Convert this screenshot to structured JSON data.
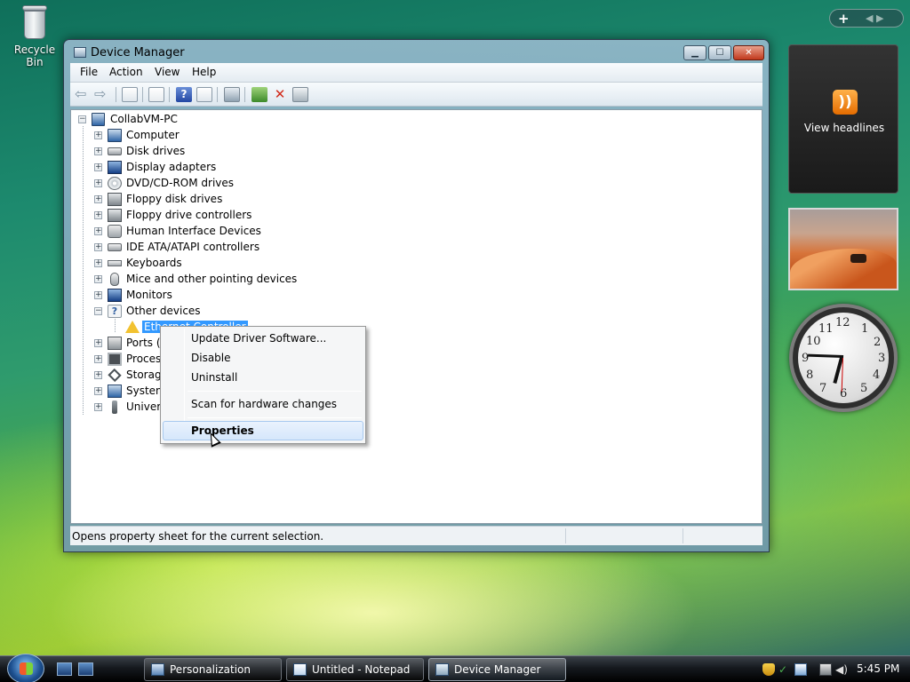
{
  "desktop": {
    "recycle_bin_label": "Recycle Bin"
  },
  "window": {
    "title": "Device Manager",
    "menu": [
      "File",
      "Action",
      "View",
      "Help"
    ],
    "status_text": "Opens property sheet for the current selection."
  },
  "tree": {
    "root": "CollabVM-PC",
    "nodes": [
      {
        "label": "Computer",
        "icon": "computer-icon",
        "expanded": false
      },
      {
        "label": "Disk drives",
        "icon": "disk-drive-icon",
        "expanded": false
      },
      {
        "label": "Display adapters",
        "icon": "display-adapter-icon",
        "expanded": false
      },
      {
        "label": "DVD/CD-ROM drives",
        "icon": "cd-drive-icon",
        "expanded": false
      },
      {
        "label": "Floppy disk drives",
        "icon": "floppy-drive-icon",
        "expanded": false
      },
      {
        "label": "Floppy drive controllers",
        "icon": "floppy-controller-icon",
        "expanded": false
      },
      {
        "label": "Human Interface Devices",
        "icon": "hid-icon",
        "expanded": false
      },
      {
        "label": "IDE ATA/ATAPI controllers",
        "icon": "ide-controller-icon",
        "expanded": false
      },
      {
        "label": "Keyboards",
        "icon": "keyboard-icon",
        "expanded": false
      },
      {
        "label": "Mice and other pointing devices",
        "icon": "mouse-icon",
        "expanded": false
      },
      {
        "label": "Monitors",
        "icon": "monitor-icon",
        "expanded": false
      },
      {
        "label": "Other devices",
        "icon": "unknown-device-icon",
        "expanded": true
      }
    ],
    "child": {
      "label": "Ethernet Controller",
      "icon": "warning-icon",
      "selected": true
    },
    "nodes_after": [
      {
        "label": "Ports (C",
        "icon": "port-icon"
      },
      {
        "label": "Process",
        "icon": "processor-icon"
      },
      {
        "label": "Storage",
        "icon": "storage-icon"
      },
      {
        "label": "System",
        "icon": "system-icon"
      },
      {
        "label": "Univers",
        "icon": "usb-icon"
      }
    ]
  },
  "context_menu": {
    "items": [
      {
        "label": "Update Driver Software...",
        "bold": false,
        "hovered": false
      },
      {
        "label": "Disable",
        "bold": false,
        "hovered": false
      },
      {
        "label": "Uninstall",
        "bold": false,
        "hovered": false
      },
      {
        "label": "Scan for hardware changes",
        "bold": false,
        "hovered": false
      },
      {
        "label": "Properties",
        "bold": true,
        "hovered": true
      }
    ]
  },
  "gadgets": {
    "feed_label": "View headlines",
    "clock_numbers": [
      "12",
      "1",
      "2",
      "3",
      "4",
      "5",
      "6",
      "7",
      "8",
      "9",
      "10",
      "11"
    ]
  },
  "taskbar": {
    "buttons": [
      {
        "label": "Personalization",
        "active": false
      },
      {
        "label": "Untitled - Notepad",
        "active": false
      },
      {
        "label": "Device Manager",
        "active": true
      }
    ],
    "time": "5:45 PM"
  }
}
